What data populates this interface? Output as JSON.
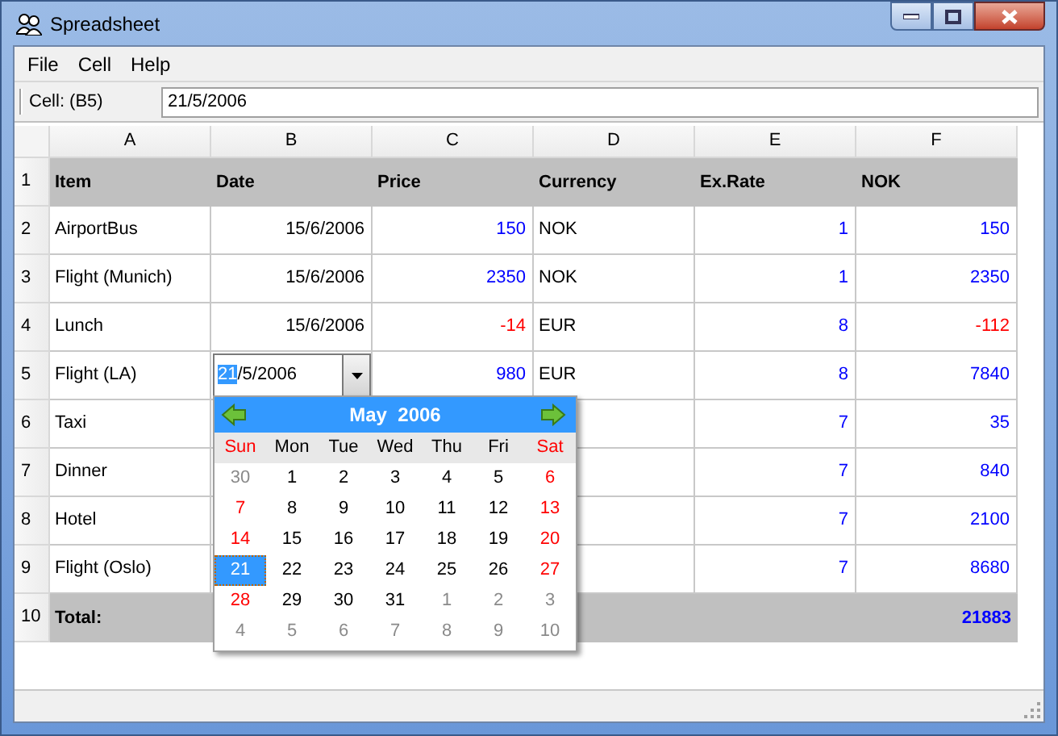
{
  "window": {
    "title": "Spreadsheet"
  },
  "menu": [
    "File",
    "Cell",
    "Help"
  ],
  "cell_bar": {
    "label": "Cell: (B5)",
    "value": "21/5/2006"
  },
  "columns": [
    "A",
    "B",
    "C",
    "D",
    "E",
    "F"
  ],
  "rows": [
    {
      "number": "1",
      "kind": "heading",
      "cells": [
        {
          "text": "Item",
          "kind": "text"
        },
        {
          "text": "Date",
          "kind": "text"
        },
        {
          "text": "Price",
          "kind": "text"
        },
        {
          "text": "Currency",
          "kind": "text"
        },
        {
          "text": "Ex.Rate",
          "kind": "text"
        },
        {
          "text": "NOK",
          "kind": "text"
        }
      ]
    },
    {
      "number": "2",
      "kind": "data",
      "cells": [
        {
          "text": "AirportBus",
          "kind": "text"
        },
        {
          "text": "15/6/2006",
          "kind": "date"
        },
        {
          "text": "150",
          "kind": "number"
        },
        {
          "text": "NOK",
          "kind": "text"
        },
        {
          "text": "1",
          "kind": "number"
        },
        {
          "text": "150",
          "kind": "number"
        }
      ]
    },
    {
      "number": "3",
      "kind": "data",
      "cells": [
        {
          "text": "Flight (Munich)",
          "kind": "text"
        },
        {
          "text": "15/6/2006",
          "kind": "date"
        },
        {
          "text": "2350",
          "kind": "number"
        },
        {
          "text": "NOK",
          "kind": "text"
        },
        {
          "text": "1",
          "kind": "number"
        },
        {
          "text": "2350",
          "kind": "number"
        }
      ]
    },
    {
      "number": "4",
      "kind": "data",
      "cells": [
        {
          "text": "Lunch",
          "kind": "text"
        },
        {
          "text": "15/6/2006",
          "kind": "date"
        },
        {
          "text": "-14",
          "kind": "negative"
        },
        {
          "text": "EUR",
          "kind": "text"
        },
        {
          "text": "8",
          "kind": "number"
        },
        {
          "text": "-112",
          "kind": "negative"
        }
      ]
    },
    {
      "number": "5",
      "kind": "data",
      "cells": [
        {
          "text": "Flight (LA)",
          "kind": "text"
        },
        {
          "kind": "editor",
          "selection": "21",
          "rest": "/5/2006"
        },
        {
          "text": "980",
          "kind": "number"
        },
        {
          "text": "EUR",
          "kind": "text"
        },
        {
          "text": "8",
          "kind": "number"
        },
        {
          "text": "7840",
          "kind": "number"
        }
      ]
    },
    {
      "number": "6",
      "kind": "data",
      "cells": [
        {
          "text": "Taxi",
          "kind": "text"
        },
        null,
        null,
        null,
        {
          "text": "7",
          "kind": "number"
        },
        {
          "text": "35",
          "kind": "number"
        }
      ]
    },
    {
      "number": "7",
      "kind": "data",
      "cells": [
        {
          "text": "Dinner",
          "kind": "text"
        },
        null,
        null,
        null,
        {
          "text": "7",
          "kind": "number"
        },
        {
          "text": "840",
          "kind": "number"
        }
      ]
    },
    {
      "number": "8",
      "kind": "data",
      "cells": [
        {
          "text": "Hotel",
          "kind": "text"
        },
        null,
        null,
        null,
        {
          "text": "7",
          "kind": "number"
        },
        {
          "text": "2100",
          "kind": "number"
        }
      ]
    },
    {
      "number": "9",
      "kind": "data",
      "cells": [
        {
          "text": "Flight (Oslo)",
          "kind": "text"
        },
        null,
        null,
        null,
        {
          "text": "7",
          "kind": "number"
        },
        {
          "text": "8680",
          "kind": "number"
        }
      ]
    },
    {
      "number": "10",
      "kind": "total",
      "cells": [
        {
          "text": "Total:",
          "kind": "text"
        },
        null,
        null,
        null,
        null,
        {
          "text": "21883",
          "kind": "number"
        }
      ]
    }
  ],
  "calendar": {
    "month": "May  2006",
    "weekdays": [
      {
        "label": "Sun",
        "weekend": true
      },
      {
        "label": "Mon",
        "weekend": false
      },
      {
        "label": "Tue",
        "weekend": false
      },
      {
        "label": "Wed",
        "weekend": false
      },
      {
        "label": "Thu",
        "weekend": false
      },
      {
        "label": "Fri",
        "weekend": false
      },
      {
        "label": "Sat",
        "weekend": true
      }
    ],
    "days": [
      {
        "day": "30",
        "in_month": false,
        "selected": false
      },
      {
        "day": "1",
        "in_month": true,
        "weekend": false,
        "selected": false
      },
      {
        "day": "2",
        "in_month": true,
        "weekend": false,
        "selected": false
      },
      {
        "day": "3",
        "in_month": true,
        "weekend": false,
        "selected": false
      },
      {
        "day": "4",
        "in_month": true,
        "weekend": false,
        "selected": false
      },
      {
        "day": "5",
        "in_month": true,
        "weekend": false,
        "selected": false
      },
      {
        "day": "6",
        "in_month": true,
        "weekend": true,
        "selected": false
      },
      {
        "day": "7",
        "in_month": true,
        "weekend": true,
        "selected": false
      },
      {
        "day": "8",
        "in_month": true,
        "weekend": false,
        "selected": false
      },
      {
        "day": "9",
        "in_month": true,
        "weekend": false,
        "selected": false
      },
      {
        "day": "10",
        "in_month": true,
        "weekend": false,
        "selected": false
      },
      {
        "day": "11",
        "in_month": true,
        "weekend": false,
        "selected": false
      },
      {
        "day": "12",
        "in_month": true,
        "weekend": false,
        "selected": false
      },
      {
        "day": "13",
        "in_month": true,
        "weekend": true,
        "selected": false
      },
      {
        "day": "14",
        "in_month": true,
        "weekend": true,
        "selected": false
      },
      {
        "day": "15",
        "in_month": true,
        "weekend": false,
        "selected": false
      },
      {
        "day": "16",
        "in_month": true,
        "weekend": false,
        "selected": false
      },
      {
        "day": "17",
        "in_month": true,
        "weekend": false,
        "selected": false
      },
      {
        "day": "18",
        "in_month": true,
        "weekend": false,
        "selected": false
      },
      {
        "day": "19",
        "in_month": true,
        "weekend": false,
        "selected": false
      },
      {
        "day": "20",
        "in_month": true,
        "weekend": true,
        "selected": false
      },
      {
        "day": "21",
        "in_month": true,
        "selected": true
      },
      {
        "day": "22",
        "in_month": true,
        "weekend": false,
        "selected": false
      },
      {
        "day": "23",
        "in_month": true,
        "weekend": false,
        "selected": false
      },
      {
        "day": "24",
        "in_month": true,
        "weekend": false,
        "selected": false
      },
      {
        "day": "25",
        "in_month": true,
        "weekend": false,
        "selected": false
      },
      {
        "day": "26",
        "in_month": true,
        "weekend": false,
        "selected": false
      },
      {
        "day": "27",
        "in_month": true,
        "weekend": true,
        "selected": false
      },
      {
        "day": "28",
        "in_month": true,
        "weekend": true,
        "selected": false
      },
      {
        "day": "29",
        "in_month": true,
        "weekend": false,
        "selected": false
      },
      {
        "day": "30",
        "in_month": true,
        "weekend": false,
        "selected": false
      },
      {
        "day": "31",
        "in_month": true,
        "weekend": false,
        "selected": false
      },
      {
        "day": "1",
        "in_month": false,
        "selected": false
      },
      {
        "day": "2",
        "in_month": false,
        "selected": false
      },
      {
        "day": "3",
        "in_month": false,
        "selected": false
      },
      {
        "day": "4",
        "in_month": false,
        "selected": false
      },
      {
        "day": "5",
        "in_month": false,
        "selected": false
      },
      {
        "day": "6",
        "in_month": false,
        "selected": false
      },
      {
        "day": "7",
        "in_month": false,
        "selected": false
      },
      {
        "day": "8",
        "in_month": false,
        "selected": false
      },
      {
        "day": "9",
        "in_month": false,
        "selected": false
      },
      {
        "day": "10",
        "in_month": false,
        "selected": false
      }
    ]
  }
}
